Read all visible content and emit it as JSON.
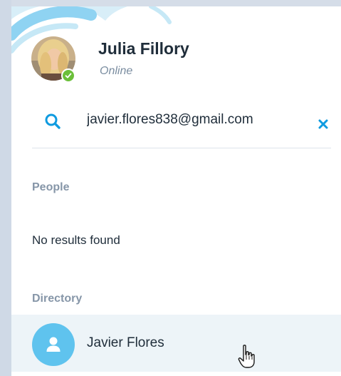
{
  "profile": {
    "name": "Julia Fillory",
    "status": "Online"
  },
  "search": {
    "query": "javier.flores838@gmail.com",
    "clear_icon": "close-icon",
    "search_icon": "search-icon"
  },
  "sections": {
    "people": {
      "label": "People",
      "empty_text": "No results found"
    },
    "directory": {
      "label": "Directory",
      "results": [
        {
          "name": "Javier Flores",
          "avatar_icon": "person-icon"
        }
      ]
    }
  },
  "colors": {
    "accent": "#0f9be0",
    "presence_online": "#6bbf3a",
    "contact_avatar": "#5fc3ee",
    "hover_row": "#edf4f8",
    "cloud_decor": "#8fd3f2"
  }
}
